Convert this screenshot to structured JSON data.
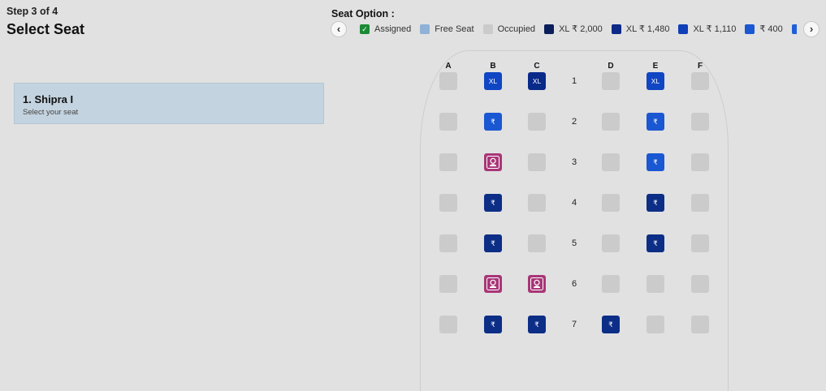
{
  "header": {
    "step": "Step 3 of 4",
    "title": "Select Seat"
  },
  "passenger": {
    "name": "1. Shipra I",
    "subtitle": "Select your seat"
  },
  "seat_options": {
    "title": "Seat Option :",
    "prev_icon": "chevron-left-icon",
    "next_icon": "chevron-right-icon",
    "legend": [
      {
        "label": "Assigned",
        "color": "#1b8a35",
        "icon": "check-icon"
      },
      {
        "label": "Free Seat",
        "color": "#8fb2d6"
      },
      {
        "label": "Occupied",
        "color": "#cbcbcb"
      },
      {
        "label": "XL ₹ 2,000",
        "color": "#0a1f5c"
      },
      {
        "label": "XL ₹ 1,480",
        "color": "#0c2a86"
      },
      {
        "label": "XL ₹ 1,110",
        "color": "#1040b8"
      },
      {
        "label": "₹ 400",
        "color": "#1a57d2"
      },
      {
        "label": "₹",
        "color": "#1f5fd8"
      }
    ]
  },
  "seat_map": {
    "columns": [
      "A",
      "B",
      "C",
      "D",
      "E",
      "F"
    ],
    "rows": [
      "1",
      "2",
      "3",
      "4",
      "5",
      "6",
      "7"
    ],
    "seats": {
      "1": [
        "free",
        "XL",
        "XL",
        "free",
        "XL",
        "free"
      ],
      "2": [
        "free",
        "₹",
        "free",
        "free",
        "₹",
        "free"
      ],
      "3": [
        "free",
        "female",
        "free",
        "free",
        "₹",
        "free"
      ],
      "4": [
        "free",
        "₹",
        "free",
        "free",
        "₹",
        "free"
      ],
      "5": [
        "free",
        "₹",
        "free",
        "free",
        "₹",
        "free"
      ],
      "6": [
        "free",
        "female",
        "female",
        "free",
        "free",
        "free"
      ],
      "7": [
        "free",
        "₹",
        "₹",
        "₹",
        "free",
        "free"
      ]
    }
  }
}
